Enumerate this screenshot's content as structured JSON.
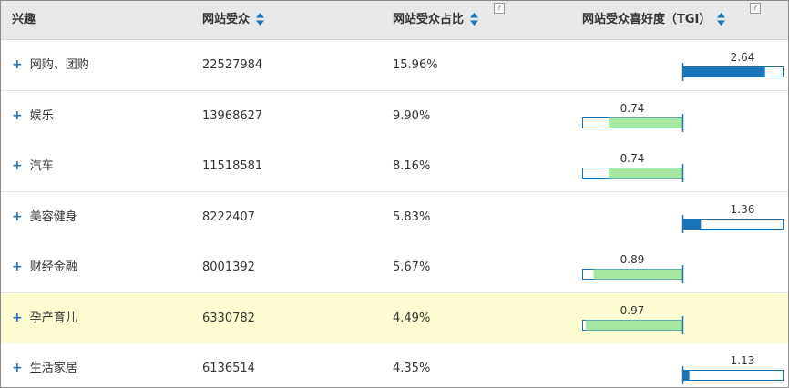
{
  "header": {
    "interest": "兴趣",
    "audience": "网站受众",
    "share": "网站受众占比",
    "tgi": "网站受众喜好度（TGI）",
    "help_glyph": "?"
  },
  "rows": [
    {
      "expand": "+",
      "name": "网购、团购",
      "audience": "22527984",
      "share": "15.96%",
      "tgi": 2.64,
      "tgi_label": "2.64"
    },
    {
      "expand": "+",
      "name": "娱乐",
      "audience": "13968627",
      "share": "9.90%",
      "tgi": 0.74,
      "tgi_label": "0.74"
    },
    {
      "expand": "+",
      "name": "汽车",
      "audience": "11518581",
      "share": "8.16%",
      "tgi": 0.74,
      "tgi_label": "0.74"
    },
    {
      "expand": "+",
      "name": "美容健身",
      "audience": "8222407",
      "share": "5.83%",
      "tgi": 1.36,
      "tgi_label": "1.36"
    },
    {
      "expand": "+",
      "name": "财经金融",
      "audience": "8001392",
      "share": "5.67%",
      "tgi": 0.89,
      "tgi_label": "0.89"
    },
    {
      "expand": "+",
      "name": "孕产育儿",
      "audience": "6330782",
      "share": "4.49%",
      "tgi": 0.97,
      "tgi_label": "0.97",
      "highlighted": true
    },
    {
      "expand": "+",
      "name": "生活家居",
      "audience": "6136514",
      "share": "4.35%",
      "tgi": 1.13,
      "tgi_label": "1.13"
    }
  ],
  "colors": {
    "above_bar": "#1a75b8",
    "below_bar": "#a4e8a4",
    "axis_line": "#1a75b8",
    "expand": "#1a75b8",
    "highlight_row": "#fefdd2",
    "header_bg": "#e8e8e8"
  },
  "icons": {
    "sort": "sort-up-down-icon",
    "help": "help-question-icon",
    "expand": "plus-icon"
  }
}
